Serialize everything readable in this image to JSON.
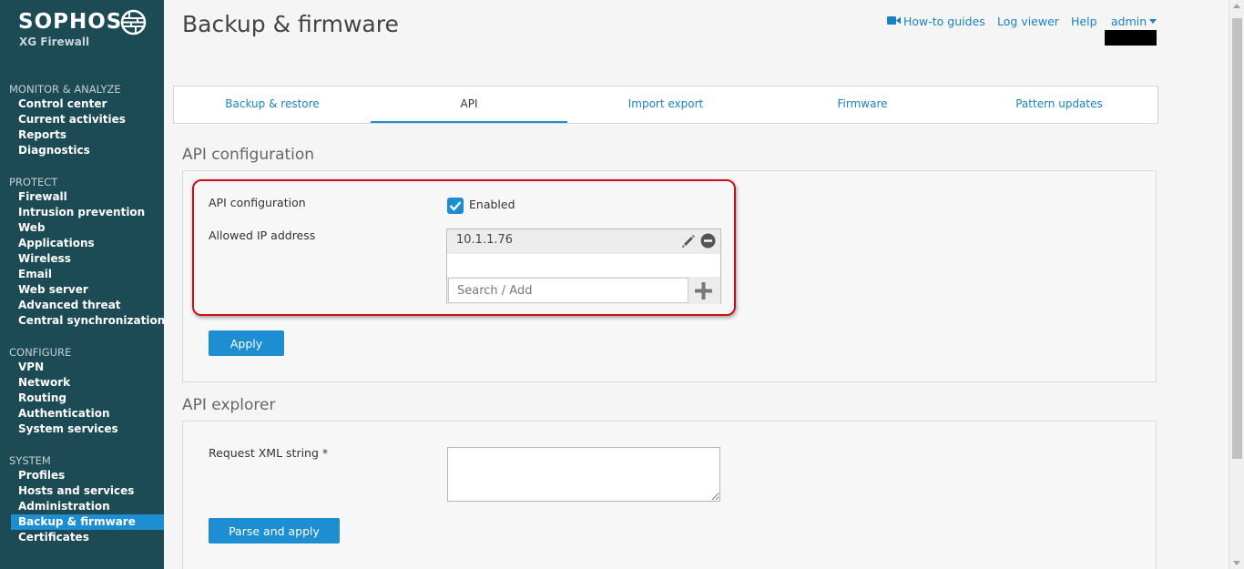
{
  "brand": {
    "name": "SOPHOS",
    "product": "XG Firewall"
  },
  "sidebar": {
    "groups": [
      {
        "heading": "MONITOR & ANALYZE",
        "items": [
          "Control center",
          "Current activities",
          "Reports",
          "Diagnostics"
        ]
      },
      {
        "heading": "PROTECT",
        "items": [
          "Firewall",
          "Intrusion prevention",
          "Web",
          "Applications",
          "Wireless",
          "Email",
          "Web server",
          "Advanced threat",
          "Central synchronization"
        ]
      },
      {
        "heading": "CONFIGURE",
        "items": [
          "VPN",
          "Network",
          "Routing",
          "Authentication",
          "System services"
        ]
      },
      {
        "heading": "SYSTEM",
        "items": [
          "Profiles",
          "Hosts and services",
          "Administration",
          "Backup & firmware",
          "Certificates"
        ]
      }
    ],
    "active_item": "Backup & firmware"
  },
  "header": {
    "title": "Backup & firmware",
    "links": {
      "howto": "How-to guides",
      "log_viewer": "Log viewer",
      "help": "Help",
      "user": "admin"
    }
  },
  "tabs": [
    "Backup & restore",
    "API",
    "Import export",
    "Firmware",
    "Pattern updates"
  ],
  "active_tab": "API",
  "api_config": {
    "section_title": "API configuration",
    "config_label": "API configuration",
    "enabled_label": "Enabled",
    "enabled": true,
    "allowed_ip_label": "Allowed IP address",
    "allowed_ips": [
      "10.1.1.76"
    ],
    "search_placeholder": "Search / Add",
    "apply_label": "Apply"
  },
  "api_explorer": {
    "section_title": "API explorer",
    "request_label": "Request XML string *",
    "request_value": "",
    "parse_label": "Parse and apply"
  },
  "colors": {
    "sidebar_bg": "#1c4b55",
    "accent": "#1c8ed1",
    "highlight": "#c8101a"
  }
}
